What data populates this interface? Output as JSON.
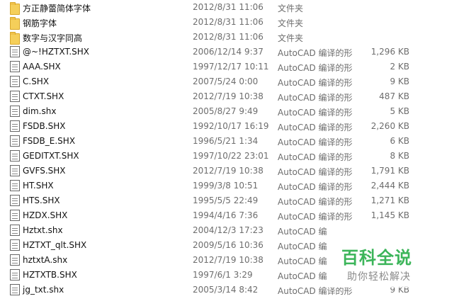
{
  "files": [
    {
      "icon": "folder-icon",
      "name": "方正静蕾简体字体",
      "date": "2012/8/31 11:06",
      "type": "文件夹",
      "size": ""
    },
    {
      "icon": "folder-icon",
      "name": "钢筋字体",
      "date": "2012/8/31 11:06",
      "type": "文件夹",
      "size": ""
    },
    {
      "icon": "folder-icon",
      "name": "数字与汉字同高",
      "date": "2012/8/31 11:06",
      "type": "文件夹",
      "size": ""
    },
    {
      "icon": "file-icon",
      "name": "@~!HZTXT.SHX",
      "date": "2006/12/14 9:37",
      "type": "AutoCAD 编译的形",
      "size": "1,296 KB"
    },
    {
      "icon": "file-icon",
      "name": "AAA.SHX",
      "date": "1997/12/17 10:11",
      "type": "AutoCAD 编译的形",
      "size": "2 KB"
    },
    {
      "icon": "file-icon",
      "name": "C.SHX",
      "date": "2007/5/24 0:00",
      "type": "AutoCAD 编译的形",
      "size": "9 KB"
    },
    {
      "icon": "file-icon",
      "name": "CTXT.SHX",
      "date": "2012/7/19 10:38",
      "type": "AutoCAD 编译的形",
      "size": "487 KB"
    },
    {
      "icon": "file-icon",
      "name": "dim.shx",
      "date": "2005/8/27 9:49",
      "type": "AutoCAD 编译的形",
      "size": "5 KB"
    },
    {
      "icon": "file-icon",
      "name": "FSDB.SHX",
      "date": "1992/10/17 16:19",
      "type": "AutoCAD 编译的形",
      "size": "2,260 KB"
    },
    {
      "icon": "file-icon",
      "name": "FSDB_E.SHX",
      "date": "1996/5/21 1:34",
      "type": "AutoCAD 编译的形",
      "size": "6 KB"
    },
    {
      "icon": "file-icon",
      "name": "GEDITXT.SHX",
      "date": "1997/10/22 23:01",
      "type": "AutoCAD 编译的形",
      "size": "8 KB"
    },
    {
      "icon": "file-icon",
      "name": "GVFS.SHX",
      "date": "2012/7/19 10:38",
      "type": "AutoCAD 编译的形",
      "size": "1,791 KB"
    },
    {
      "icon": "file-icon",
      "name": "HT.SHX",
      "date": "1999/3/8 10:51",
      "type": "AutoCAD 编译的形",
      "size": "2,444 KB"
    },
    {
      "icon": "file-icon",
      "name": "HTS.SHX",
      "date": "1995/5/5 22:49",
      "type": "AutoCAD 编译的形",
      "size": "1,271 KB"
    },
    {
      "icon": "file-icon",
      "name": "HZDX.SHX",
      "date": "1994/4/16 7:36",
      "type": "AutoCAD 编译的形",
      "size": "1,145 KB"
    },
    {
      "icon": "file-icon",
      "name": "Hztxt.shx",
      "date": "2004/12/3 17:23",
      "type": "AutoCAD 编",
      "size": ""
    },
    {
      "icon": "file-icon",
      "name": "HZTXT_qlt.SHX",
      "date": "2009/5/16 10:36",
      "type": "AutoCAD 编",
      "size": ""
    },
    {
      "icon": "file-icon",
      "name": "hztxtA.shx",
      "date": "2012/7/19 10:38",
      "type": "AutoCAD 编",
      "size": ""
    },
    {
      "icon": "file-icon",
      "name": "HZTXTB.SHX",
      "date": "1997/6/1 3:29",
      "type": "AutoCAD 编",
      "size": ""
    },
    {
      "icon": "file-icon",
      "name": "jg_txt.shx",
      "date": "2005/3/14 8:42",
      "type": "AutoCAD 编译的形",
      "size": "9 KB"
    }
  ],
  "watermark": {
    "title": "百科全说",
    "subtitle": "助你轻松解决"
  }
}
